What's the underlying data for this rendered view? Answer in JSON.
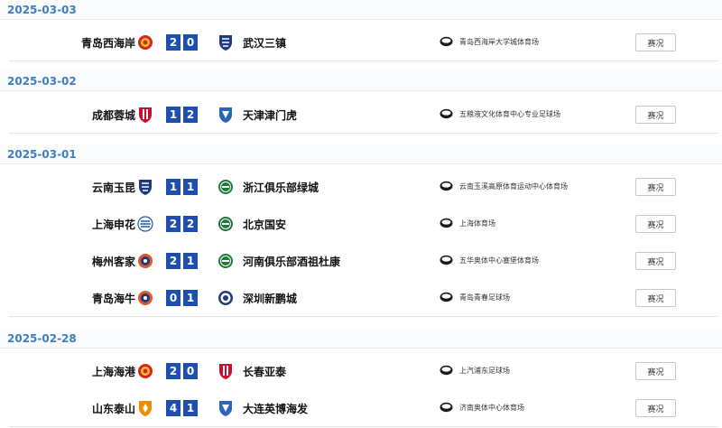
{
  "groups": [
    {
      "date": "2025-03-03",
      "matches": [
        {
          "home": "青岛西海岸",
          "home_score": "2",
          "away_score": "0",
          "away": "武汉三镇",
          "venue": "青岛西海岸大学城体育场",
          "report": "赛况",
          "home_logo": "logo-red-round",
          "away_logo": "logo-navy-shield"
        }
      ]
    },
    {
      "date": "2025-03-02",
      "matches": [
        {
          "home": "成都蓉城",
          "home_score": "1",
          "away_score": "2",
          "away": "天津津门虎",
          "venue": "五粮液文化体育中心专业足球场",
          "report": "赛况",
          "home_logo": "logo-red-shield",
          "away_logo": "logo-blue-shield"
        }
      ]
    },
    {
      "date": "2025-03-01",
      "matches": [
        {
          "home": "云南玉昆",
          "home_score": "1",
          "away_score": "1",
          "away": "浙江俱乐部绿城",
          "venue": "云南玉溪高原体育运动中心体育场",
          "report": "赛况",
          "home_logo": "logo-navy-shield",
          "away_logo": "logo-green-round"
        },
        {
          "home": "上海申花",
          "home_score": "2",
          "away_score": "2",
          "away": "北京国安",
          "venue": "上海体育场",
          "report": "赛况",
          "home_logo": "logo-blue-stripe",
          "away_logo": "logo-green-round"
        },
        {
          "home": "梅州客家",
          "home_score": "2",
          "away_score": "1",
          "away": "河南俱乐部酒祖杜康",
          "venue": "五华奥体中心塞堡体育场",
          "report": "赛况",
          "home_logo": "logo-orange-round",
          "away_logo": "logo-green-round"
        },
        {
          "home": "青岛海牛",
          "home_score": "0",
          "away_score": "1",
          "away": "深圳新鹏城",
          "venue": "青岛青春足球场",
          "report": "赛况",
          "home_logo": "logo-orange-round",
          "away_logo": "logo-navy-round"
        }
      ]
    },
    {
      "date": "2025-02-28",
      "matches": [
        {
          "home": "上海海港",
          "home_score": "2",
          "away_score": "0",
          "away": "长春亚泰",
          "venue": "上汽浦东足球场",
          "report": "赛况",
          "home_logo": "logo-red-round",
          "away_logo": "logo-red-shield"
        },
        {
          "home": "山东泰山",
          "home_score": "4",
          "away_score": "1",
          "away": "大连英博海发",
          "venue": "济南奥体中心体育场",
          "report": "赛况",
          "home_logo": "logo-orange-shield",
          "away_logo": "logo-blue-shield"
        }
      ]
    }
  ],
  "venue_icon": "stadium-icon",
  "colors": {
    "date": "#3d7fc1",
    "score_bg": "#1d4fb0",
    "score_text": "#ffffff"
  }
}
